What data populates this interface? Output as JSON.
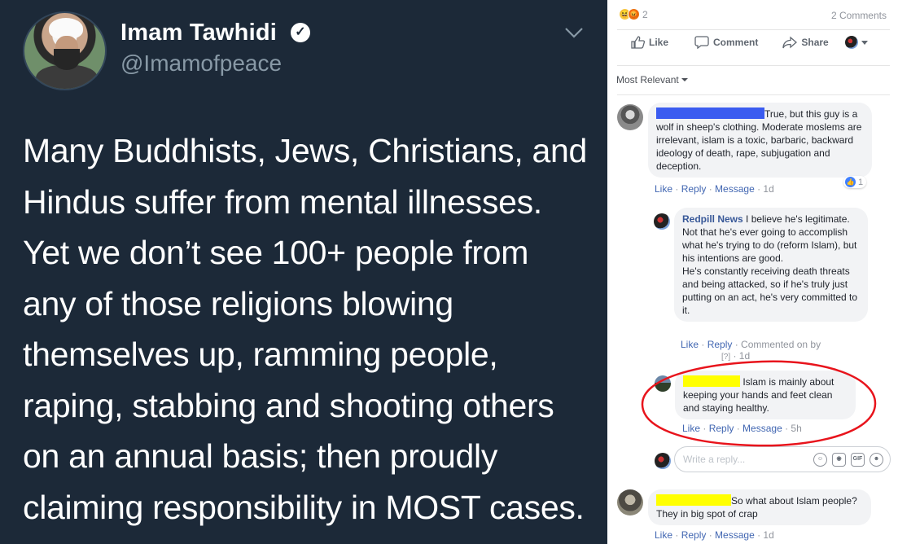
{
  "tweet": {
    "display_name": "Imam Tawhidi",
    "handle": "@Imamofpeace",
    "lines": [
      "Many Buddhists, Jews, Christians, and",
      "Hindus suffer from mental illnesses.",
      "Yet we don’t see 100+ people from",
      "any of those religions blowing",
      "themselves up, ramming people,",
      "raping, stabbing and shooting others",
      "on an annual basis; then proudly",
      "claiming responsibility in MOST cases."
    ],
    "icons": {
      "verified": "verified-badge-icon",
      "menu": "chevron-down-icon"
    }
  },
  "facebook": {
    "reactions": {
      "count": "2",
      "icons": [
        "haha-reaction-icon",
        "angry-reaction-icon"
      ]
    },
    "comments_count": "2 Comments",
    "actions": {
      "like": "Like",
      "comment": "Comment",
      "share": "Share"
    },
    "sort": "Most Relevant",
    "comments": [
      {
        "text": "True, but this guy is a wolf in sheep's clothing. Moderate moslems are irrelevant, islam is a toxic, barbaric, backward ideology of death, rape, subjugation and deception.",
        "meta": {
          "like": "Like",
          "reply": "Reply",
          "message": "Message",
          "time": "1d"
        },
        "likes": "1"
      },
      {
        "author": "Redpill News",
        "text": "I believe he's legitimate. Not that he's ever going to accomplish what he's trying to do (reform Islam), but his intentions are good.",
        "text2": "He's constantly receiving death threats and being attacked, so if he's truly just putting on an act, he's very committed to it.",
        "meta": {
          "like": "Like",
          "reply": "Reply",
          "commented_on_by": "Commented on by",
          "mark": "[?]",
          "time": "1d"
        }
      },
      {
        "text": "Islam is mainly about keeping your hands and feet clean and staying healthy.",
        "meta": {
          "like": "Like",
          "reply": "Reply",
          "message": "Message",
          "time": "5h"
        }
      },
      {
        "text": "So what about Islam people? They in big spot of crap",
        "meta": {
          "like": "Like",
          "reply": "Reply",
          "message": "Message",
          "time": "1d"
        }
      }
    ],
    "reply_placeholder": "Write a reply...",
    "reply_icons": [
      "emoji-icon",
      "camera-icon",
      "gif-icon",
      "sticker-icon"
    ],
    "annotation_color": "#e8141c"
  }
}
